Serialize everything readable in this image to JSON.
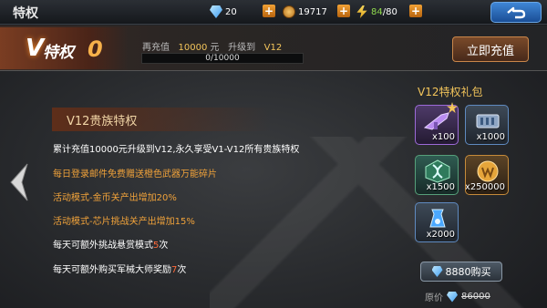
{
  "window": {
    "title": "特权"
  },
  "resources": {
    "diamonds": "20",
    "coins": "19717",
    "stamina_current": "84",
    "stamina_sep_max": "/80"
  },
  "vip": {
    "badge_v": "V",
    "badge_label": "特权",
    "level": "0",
    "recharge_prefix": "再充值",
    "recharge_amount": "10000",
    "recharge_unit": "元",
    "upgrade_prefix": "升级到",
    "target_level": "V12",
    "progress_text": "0/10000",
    "progress_fraction": 0,
    "recharge_button": "立即充值"
  },
  "panel": {
    "title": "V12贵族特权",
    "perks": [
      {
        "text": "累计充值10000元升级到V12,永久享受V1-V12所有贵族特权"
      },
      {
        "text": "每日登录邮件免费赠送橙色武器万能碎片"
      },
      {
        "text": "活动模式-金币关产出增加20%"
      },
      {
        "text": "活动模式-芯片挑战关产出增加15%"
      },
      {
        "prefix": "每天可额外挑战悬赏模式",
        "num": "5",
        "suffix": "次"
      },
      {
        "prefix": "每天可额外购买军械大师奖励",
        "num": "7",
        "suffix": "次"
      }
    ]
  },
  "gift": {
    "title": "V12特权礼包",
    "items": [
      {
        "icon": "weapon-icon",
        "qty": "x100"
      },
      {
        "icon": "ammo-icon",
        "qty": "x1000"
      },
      {
        "icon": "dna-icon",
        "qty": "x1500"
      },
      {
        "icon": "gold-medal-icon",
        "qty": "x250000"
      },
      {
        "icon": "energy-vial-icon",
        "qty": "x2000"
      }
    ],
    "buy_price": "8880购买",
    "original_label": "原价",
    "original_price": "86000"
  },
  "colors": {
    "accent": "#f0a23a",
    "highlight": "#f3c55b",
    "link_blue": "#1a4e96"
  }
}
